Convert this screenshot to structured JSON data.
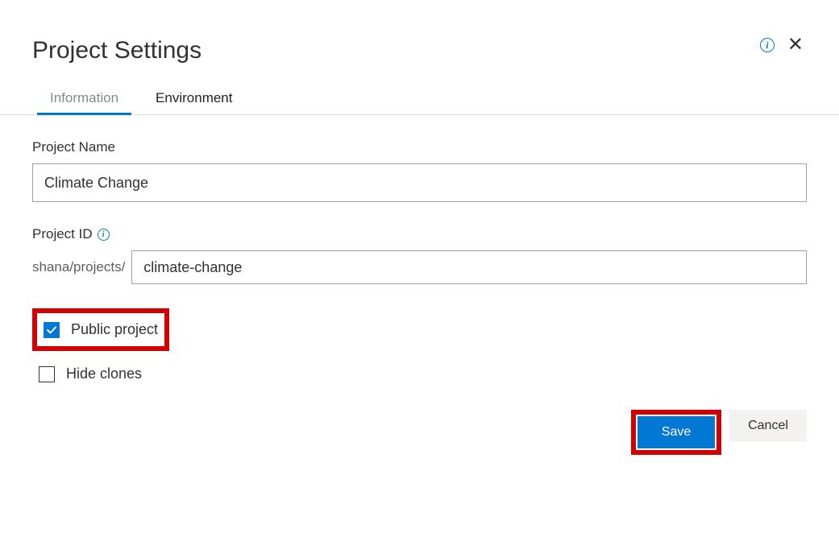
{
  "header": {
    "title": "Project Settings"
  },
  "tabs": {
    "information": "Information",
    "environment": "Environment"
  },
  "form": {
    "name_label": "Project Name",
    "name_value": "Climate Change",
    "id_label": "Project ID",
    "id_prefix": "shana/projects/",
    "id_value": "climate-change",
    "public_label": "Public project",
    "public_checked": true,
    "hide_clones_label": "Hide clones",
    "hide_clones_checked": false
  },
  "buttons": {
    "save": "Save",
    "cancel": "Cancel"
  },
  "info_glyph": "i",
  "close_glyph": "✕"
}
